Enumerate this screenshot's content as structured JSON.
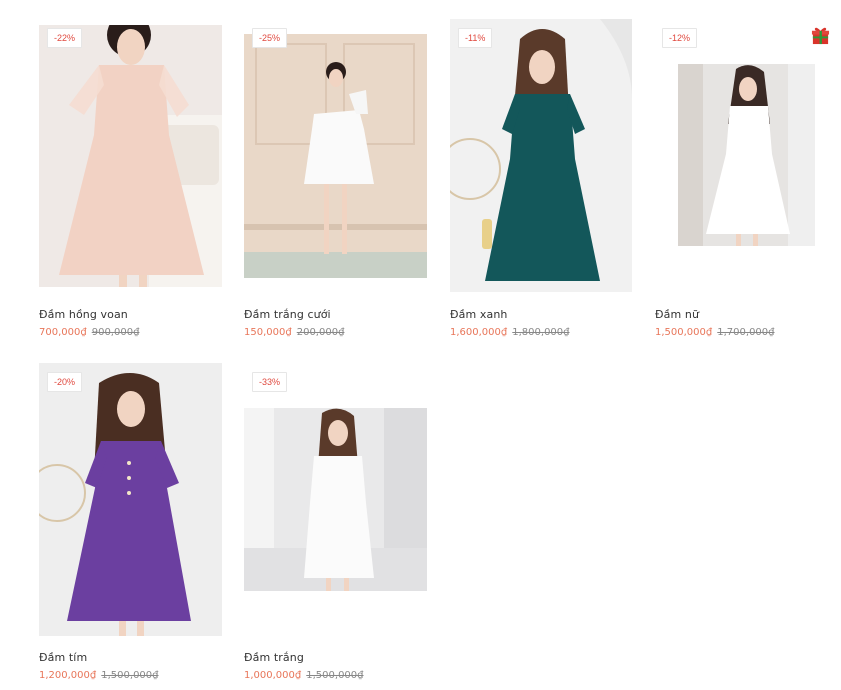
{
  "products": [
    {
      "badge": "-22%",
      "name": "Đầm hồng voan",
      "price": "700,000₫",
      "old_price": "900,000₫",
      "dress_color": "#f2d2c4",
      "bg": "#efe9e6"
    },
    {
      "badge": "-25%",
      "name": "Đầm trắng cưới",
      "price": "150,000₫",
      "old_price": "200,000₫",
      "dress_color": "#fafafa",
      "bg": "#e9d8c8"
    },
    {
      "badge": "-11%",
      "name": "Đầm xanh",
      "price": "1,600,000₫",
      "old_price": "1,800,000₫",
      "dress_color": "#13575a",
      "bg": "#f1f1f1"
    },
    {
      "badge": "-12%",
      "name": "Đầm nữ",
      "price": "1,500,000₫",
      "old_price": "1,700,000₫",
      "dress_color": "#ffffff",
      "bg": "#e6e4e2"
    },
    {
      "badge": "-20%",
      "name": "Đầm tím",
      "price": "1,200,000₫",
      "old_price": "1,500,000₫",
      "dress_color": "#6b3fa0",
      "bg": "#eeeeee"
    },
    {
      "badge": "-33%",
      "name": "Đầm trắng",
      "price": "1,000,000₫",
      "old_price": "1,500,000₫",
      "dress_color": "#fbfbfb",
      "bg": "#e9e9ea"
    }
  ],
  "gift": {
    "icon": "gift-icon",
    "color": "#d9342b"
  }
}
